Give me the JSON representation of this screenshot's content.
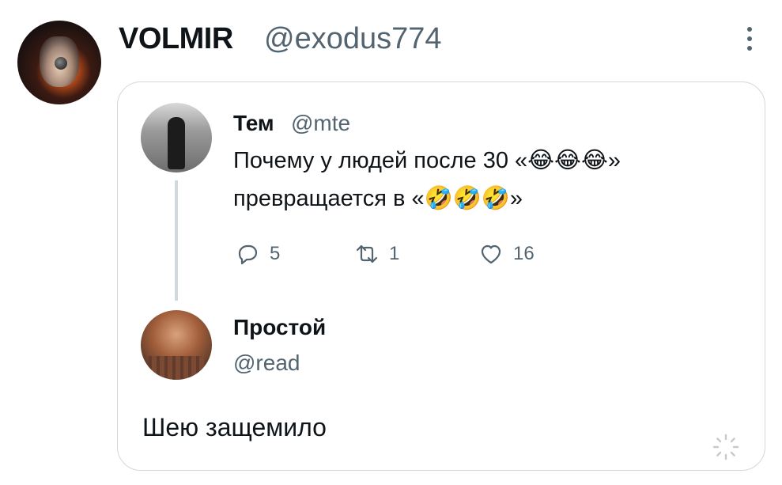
{
  "author": {
    "name": "VOLMIR",
    "handle": "@exodus774"
  },
  "quoted": {
    "name": "Тем",
    "handle": "@mte",
    "text_line1_prefix": "Почему у людей после 30 «",
    "text_line1_emoji": "😂😂😂",
    "text_line1_suffix": "»",
    "text_line2_prefix": "превращается в «",
    "text_line2_emoji": "🤣🤣🤣",
    "text_line2_suffix": "»",
    "replies": "5",
    "retweets": "1",
    "likes": "16"
  },
  "reply": {
    "name": "Простой",
    "handle": "@read",
    "text": "Шею защемило"
  },
  "icons": [
    "more-icon",
    "reply-icon",
    "retweet-icon",
    "like-icon",
    "loading-icon"
  ]
}
